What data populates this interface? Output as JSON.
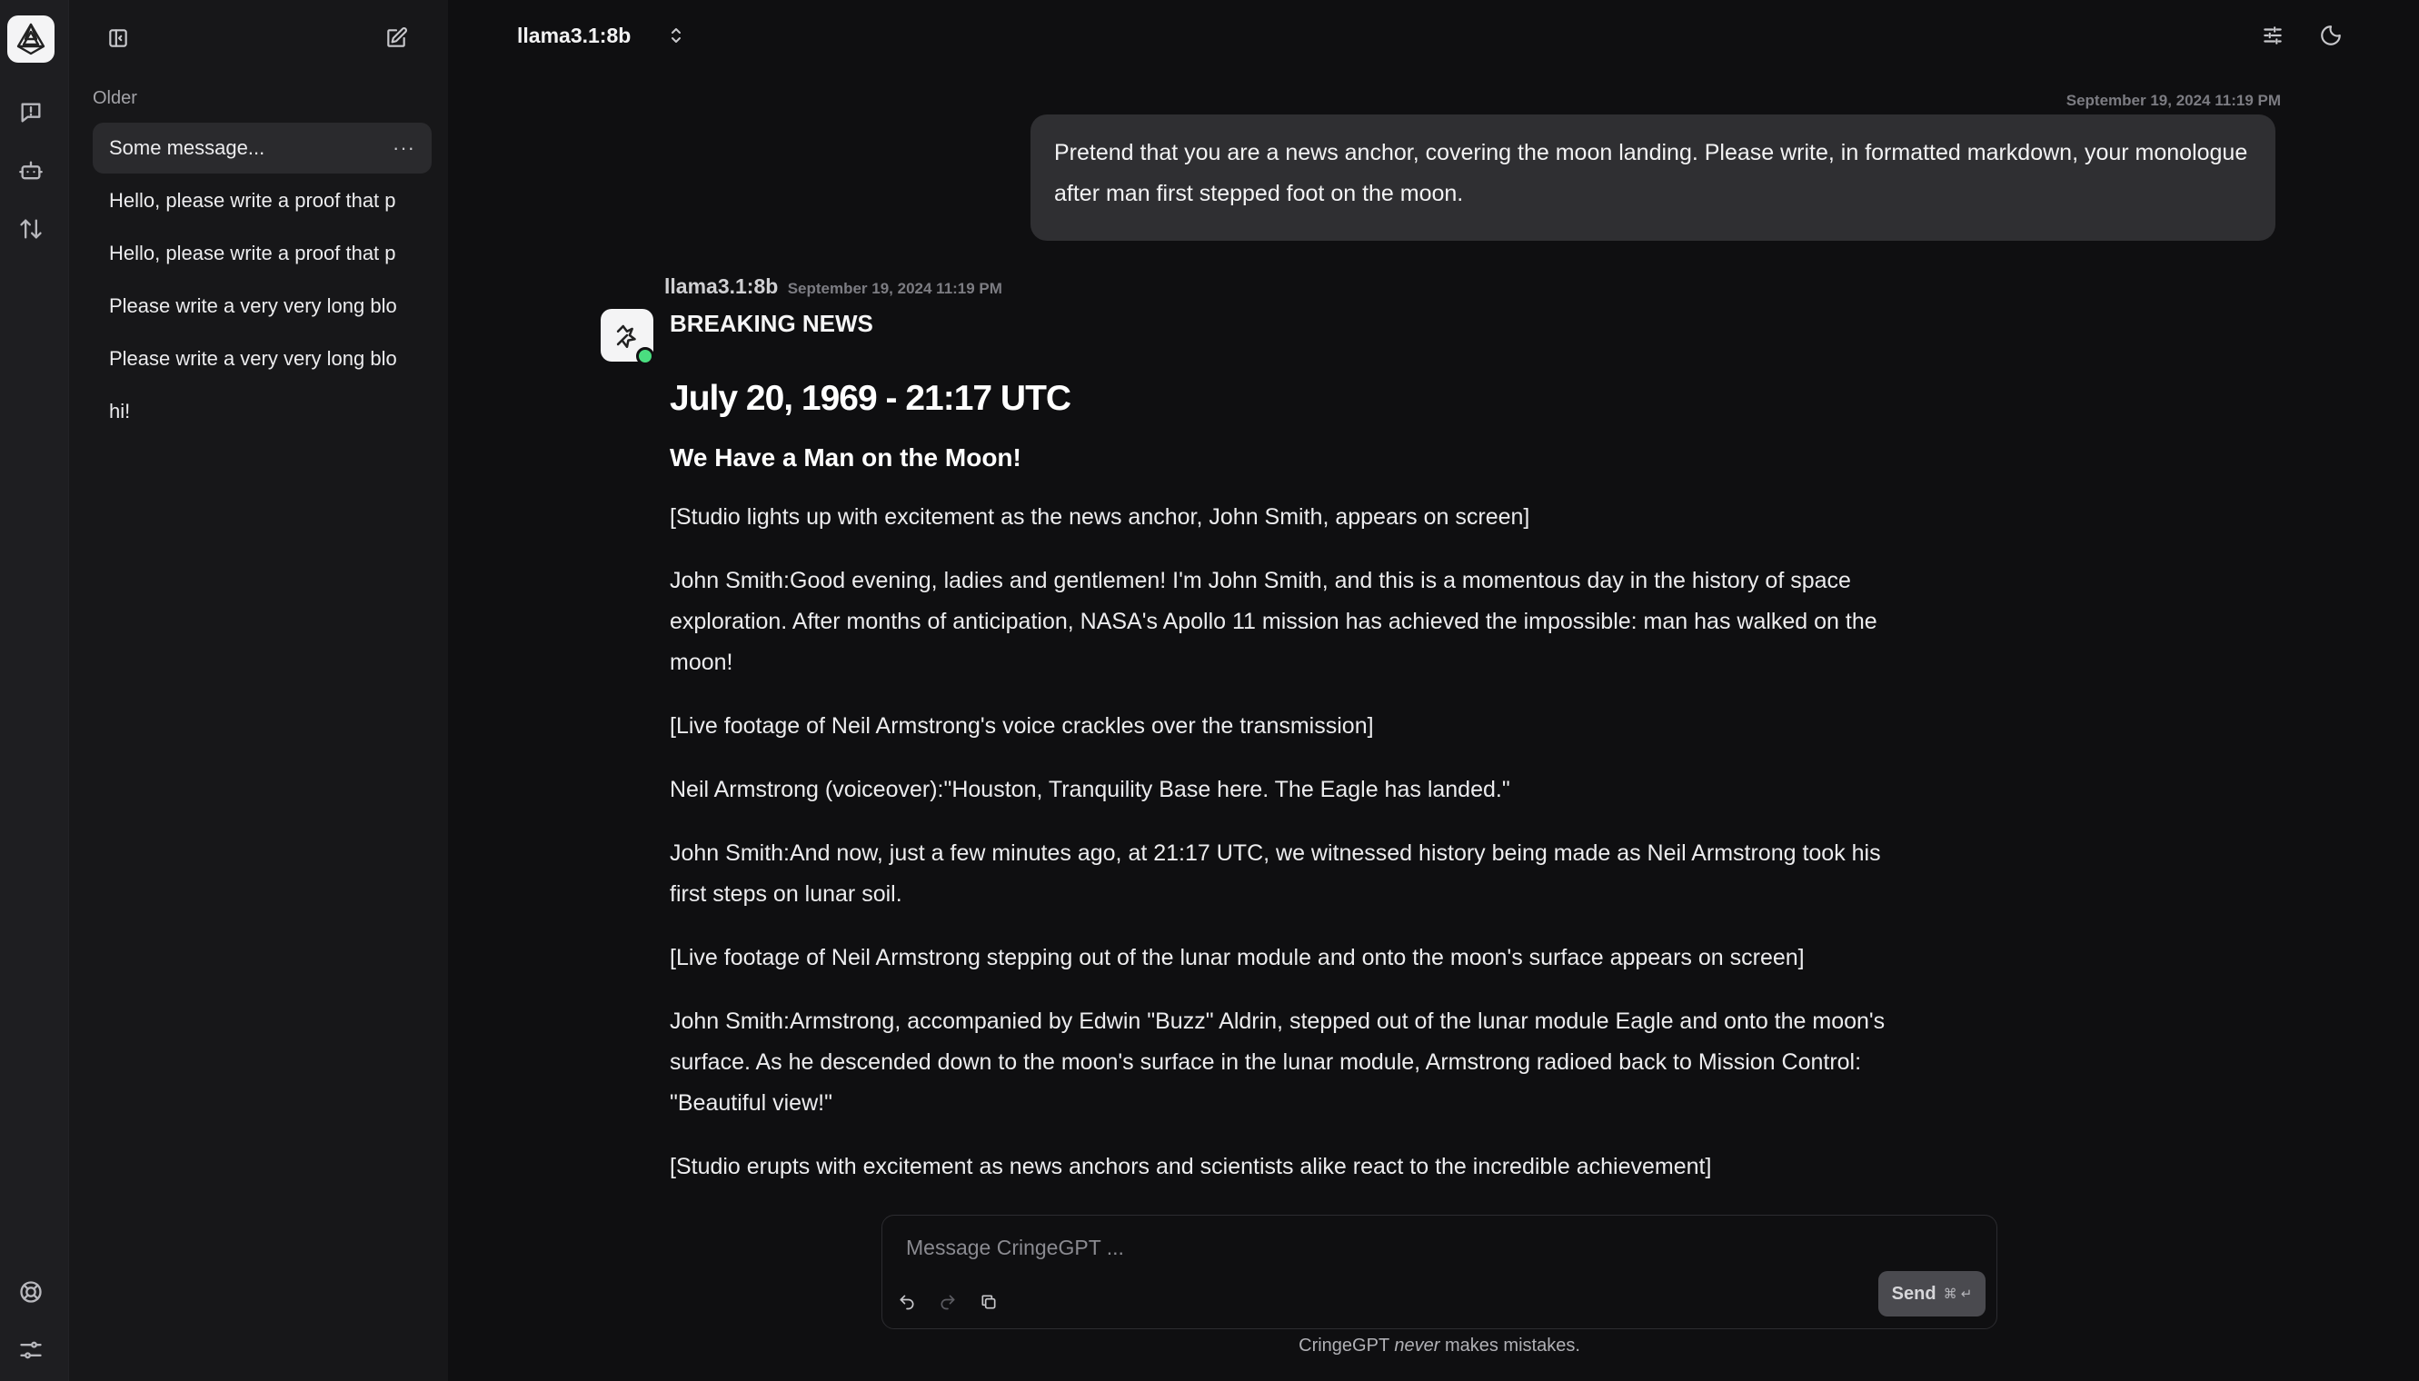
{
  "rail": {
    "icons": [
      "app-logo",
      "chat-bubble-icon",
      "robot-icon",
      "arrows-up-down-icon",
      "lifebuoy-icon",
      "sliders-icon"
    ]
  },
  "sidebar": {
    "section_label": "Older",
    "chats": [
      {
        "label": "Some message...",
        "active": true
      },
      {
        "label": "Hello, please write a proof that p"
      },
      {
        "label": "Hello, please write a proof that p"
      },
      {
        "label": "Please write a very very long blo"
      },
      {
        "label": "Please write a very very long blo"
      },
      {
        "label": "hi!"
      }
    ],
    "more_label": "···"
  },
  "header": {
    "model_name": "llama3.1:8b"
  },
  "conversation": {
    "user_message": {
      "timestamp": "September 19, 2024 11:19 PM",
      "text": "Pretend that you are a news anchor, covering the moon landing. Please write, in formatted markdown, your monologue after man first stepped foot on the moon."
    },
    "assistant_message": {
      "model": "llama3.1:8b",
      "timestamp": "September 19, 2024 11:19 PM",
      "heading_breaking": "BREAKING NEWS",
      "heading_date": "July 20, 1969 - 21:17 UTC",
      "heading_sub": "We Have a Man on the Moon!",
      "paragraphs": [
        "[Studio lights up with excitement as the news anchor, John Smith, appears on screen]",
        "John Smith:Good evening, ladies and gentlemen! I'm John Smith, and this is a momentous day in the history of space exploration. After months of anticipation, NASA's Apollo 11 mission has achieved the impossible: man has walked on the moon!",
        "[Live footage of Neil Armstrong's voice crackles over the transmission]",
        "Neil Armstrong (voiceover):\"Houston, Tranquility Base here. The Eagle has landed.\"",
        "John Smith:And now, just a few minutes ago, at 21:17 UTC, we witnessed history being made as Neil Armstrong took his first steps on lunar soil.",
        "[Live footage of Neil Armstrong stepping out of the lunar module and onto the moon's surface appears on screen]",
        "John Smith:Armstrong, accompanied by Edwin \"Buzz\" Aldrin, stepped out of the lunar module Eagle and onto the moon's surface. As he descended down to the moon's surface in the lunar module, Armstrong radioed back to Mission Control: \"Beautiful view!\"",
        "[Studio erupts with excitement as news anchors and scientists alike react to the incredible achievement]"
      ]
    }
  },
  "composer": {
    "placeholder": "Message CringeGPT ...",
    "send_label": "Send",
    "send_shortcut": "⌘ ↵"
  },
  "footer": {
    "before": "CringeGPT ",
    "emphasis": "never",
    "after": " makes mistakes."
  },
  "colors": {
    "background": "#0f0f11",
    "sidebar": "#171719",
    "rail": "#1e1e21",
    "user_bubble": "#2f2f32",
    "online": "#4ade80"
  }
}
